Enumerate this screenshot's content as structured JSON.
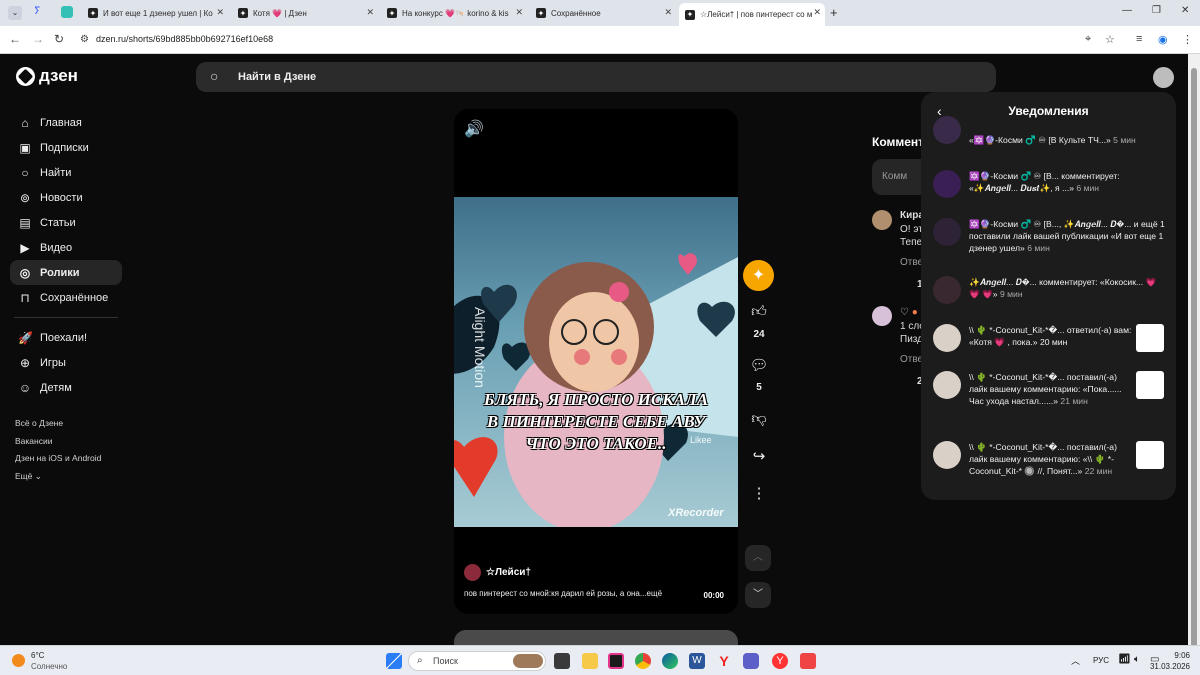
{
  "browser": {
    "tabs": [
      {
        "label": "И вот еще 1 дзенер ушел | Ко",
        "icon": "dzen-icon"
      },
      {
        "label": "Котя 💗 | Дзен",
        "icon": "dzen-icon"
      },
      {
        "label": "На конкурс 💗🐚 korino & kis",
        "icon": "dzen-icon"
      },
      {
        "label": "Сохранённое",
        "icon": "dzen-icon"
      },
      {
        "label": "☆Лейси† | пов пинтерест со м",
        "icon": "dzen-icon"
      }
    ],
    "new_tab": "+",
    "url": "dzen.ru/shorts/69bd885bb0b692716ef10e68"
  },
  "header": {
    "logo_text": "дзен",
    "search_placeholder": "Найти в Дзене"
  },
  "sidebar": {
    "items": [
      {
        "label": "Главная",
        "icon": "home-icon"
      },
      {
        "label": "Подписки",
        "icon": "subscriptions-icon"
      },
      {
        "label": "Найти",
        "icon": "search-icon"
      },
      {
        "label": "Новости",
        "icon": "news-icon"
      },
      {
        "label": "Статьи",
        "icon": "articles-icon"
      },
      {
        "label": "Видео",
        "icon": "video-icon"
      },
      {
        "label": "Ролики",
        "icon": "shorts-icon"
      },
      {
        "label": "Сохранённое",
        "icon": "bookmark-icon"
      }
    ],
    "extra": [
      {
        "label": "Поехали!",
        "icon": "rocket-icon"
      },
      {
        "label": "Игры",
        "icon": "games-icon"
      },
      {
        "label": "Детям",
        "icon": "kids-icon"
      }
    ],
    "footer": [
      "Всё о Дзене",
      "Вакансии",
      "Дзен на iOS и Android",
      "Ещё"
    ]
  },
  "video": {
    "caption_line1": "БЛЯТЬ, Я ПРОСТО ИСКАЛА",
    "caption_line2": "В ПИНТЕРЕСТЕ СЕБЕ АВУ",
    "caption_line3": "ЧТО ЭТО ТАКОЕ..",
    "watermark_left": "Alight Motion",
    "watermark_recorder": "XRecorder",
    "watermark_likee": "Likee",
    "channel": "☆Лейси†",
    "description": "пов пинтерест со мной:кя дарил ей розы, а она...ещё",
    "time": "00:00",
    "likes": "24",
    "comments": "5"
  },
  "comments_bg": {
    "title": "Коммент",
    "input_placeholder": "Комм",
    "c1_author": "Кира",
    "c1_line1": "О! эт",
    "c1_line2": "Тепе",
    "c1_reply": "Отве",
    "c1_count": "1",
    "c2_author": "♡",
    "c2_line1": "1 сло",
    "c2_line2": "Пизд",
    "c2_reply": "Отве",
    "c2_count": "2"
  },
  "notifications": {
    "title": "Уведомления",
    "items": [
      {
        "text": "«🔯🔮-Косми ♂️ ♾ [В Культе ТЧ...»",
        "time": "5 мин"
      },
      {
        "text": "🔯🔮-Косми ♂️ ♾ [В... комментирует: «✨𝑨𝒏𝒈𝒆𝒍𝒍... 𝑫𝒖𝒔𝒕✨, я ...»",
        "time": "6 мин"
      },
      {
        "text": "🔯🔮-Косми ♂️ ♾ [В..., ✨𝑨𝒏𝒈𝒆𝒍𝒍... 𝑫�... и ещё 1 поставили лайк вашей публикации «И вот еще 1 дзенер ушел»",
        "time": "6 мин"
      },
      {
        "text": "✨𝑨𝒏𝒈𝒆𝒍𝒍... 𝑫�... комментирует: «Кокосик... 💗 💗 💗»",
        "time": "9 мин"
      },
      {
        "text": "\\\\ 🌵 *-Coconut_Kit-*�... ответил(-а) вам: «Котя 💗 , пока.»",
        "time": "20 мин"
      },
      {
        "text": "\\\\ 🌵 *-Coconut_Kit-*�... поставил(-а) лайк вашему комментарию: «Пока...... Час ухода настал......»",
        "time": "21 мин"
      },
      {
        "text": "\\\\ 🌵 *-Coconut_Kit-*�... поставил(-а) лайк вашему комментарию: «\\\\ 🌵 *-Coconut_Kit-* 🔘 //, Понят...»",
        "time": "22 мин"
      }
    ]
  },
  "taskbar": {
    "weather_temp": "6°C",
    "weather_desc": "Солнечно",
    "search_label": "Поиск",
    "lang": "РУС",
    "time": "9:06",
    "date": "31.03.2026"
  }
}
